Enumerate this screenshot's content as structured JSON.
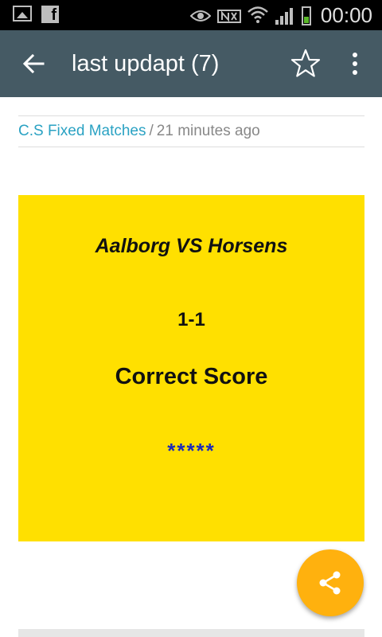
{
  "status_bar": {
    "time": "00:00",
    "icons": [
      "image-icon",
      "facebook-icon",
      "eye-icon",
      "nfc-icon",
      "wifi-icon",
      "signal-icon",
      "battery-icon"
    ]
  },
  "app_bar": {
    "title": "last updapt (7)",
    "background": "#455a64"
  },
  "meta": {
    "category": "C.S Fixed Matches",
    "separator": "/",
    "time_ago": "21 minutes ago",
    "category_color": "#2aa2c3"
  },
  "post_image": {
    "background": "#ffe000",
    "match": "Aalborg VS Horsens",
    "score": "1-1",
    "type": "Correct Score",
    "stars": "*****"
  },
  "fab": {
    "icon": "share-icon",
    "color": "#ffb10e"
  }
}
